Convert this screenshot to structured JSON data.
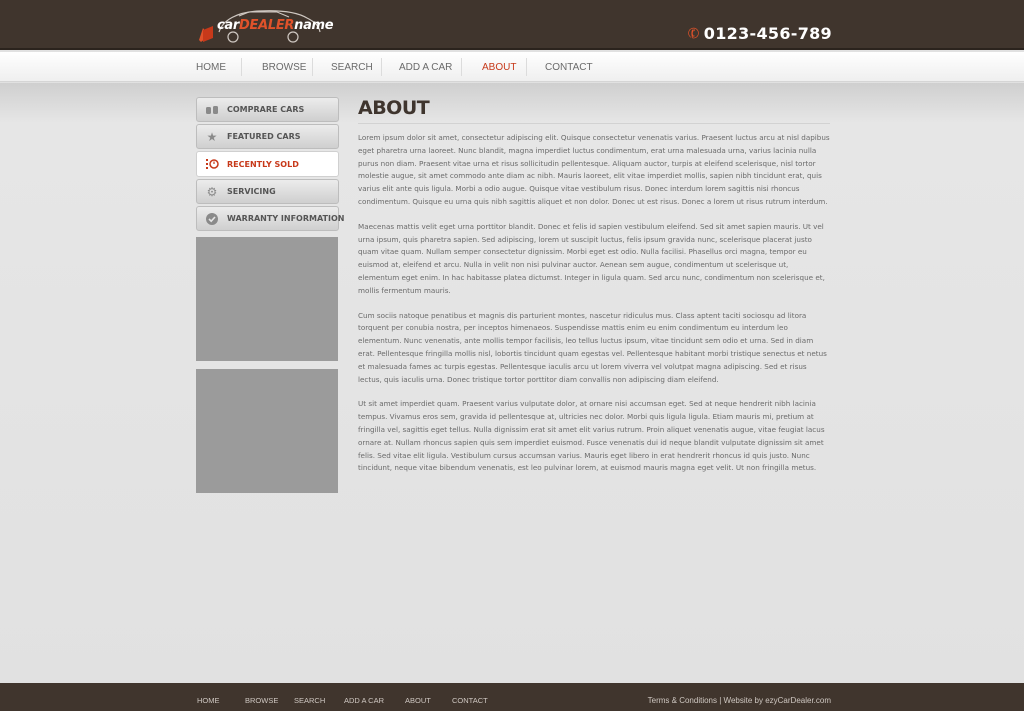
{
  "header": {
    "logo": {
      "part1": "car",
      "part2": "DEALER",
      "part3": "name"
    },
    "phone": "0123-456-789"
  },
  "nav": {
    "items": [
      "HOME",
      "BROWSE",
      "SEARCH",
      "ADD A CAR",
      "ABOUT",
      "CONTACT"
    ],
    "active": "ABOUT"
  },
  "sidebar": {
    "items": [
      {
        "label": "COMPRARE CARS",
        "icon": "compare-icon"
      },
      {
        "label": "FEATURED CARS",
        "icon": "star-icon"
      },
      {
        "label": "RECENTLY SOLD",
        "icon": "sold-icon",
        "active": true
      },
      {
        "label": "SERVICING",
        "icon": "gear-icon"
      },
      {
        "label": "WARRANTY INFORMATION",
        "icon": "check-icon"
      }
    ]
  },
  "main": {
    "title": "ABOUT",
    "paragraphs": [
      "Lorem ipsum dolor sit amet, consectetur adipiscing elit. Quisque consectetur venenatis varius. Praesent luctus arcu at nisl dapibus eget pharetra urna laoreet. Nunc blandit, magna imperdiet luctus condimentum, erat urna malesuada urna, varius lacinia nulla purus non diam. Praesent vitae urna et risus sollicitudin pellentesque. Aliquam auctor, turpis at eleifend scelerisque, nisl tortor molestie augue, sit amet commodo ante diam ac nibh. Mauris laoreet, elit vitae imperdiet mollis, sapien nibh tincidunt erat, quis varius elit ante quis ligula. Morbi a odio augue. Quisque vitae vestibulum risus. Donec interdum lorem sagittis nisi rhoncus condimentum. Quisque eu urna quis nibh sagittis aliquet et non dolor. Donec ut est risus. Donec a lorem ut risus rutrum interdum.",
      "Maecenas mattis velit eget urna porttitor blandit. Donec et felis id sapien vestibulum eleifend. Sed sit amet sapien mauris. Ut vel urna ipsum, quis pharetra sapien. Sed adipiscing, lorem ut suscipit luctus, felis ipsum gravida nunc, scelerisque placerat justo quam vitae quam. Nullam semper consectetur dignissim. Morbi eget est odio. Nulla facilisi. Phasellus orci magna, tempor eu euismod at, eleifend et arcu. Nulla in velit non nisi pulvinar auctor. Aenean sem augue, condimentum ut scelerisque ut, elementum eget enim. In hac habitasse platea dictumst. Integer in ligula quam. Sed arcu nunc, condimentum non scelerisque et, mollis fermentum mauris.",
      "Cum sociis natoque penatibus et magnis dis parturient montes, nascetur ridiculus mus. Class aptent taciti sociosqu ad litora torquent per conubia nostra, per inceptos himenaeos. Suspendisse mattis enim eu enim condimentum eu interdum leo elementum. Nunc venenatis, ante mollis tempor facilisis, leo tellus luctus ipsum, vitae tincidunt sem odio et urna. Sed in diam erat. Pellentesque fringilla mollis nisl, lobortis tincidunt quam egestas vel. Pellentesque habitant morbi tristique senectus et netus et malesuada fames ac turpis egestas. Pellentesque iaculis arcu ut lorem viverra vel volutpat magna adipiscing. Sed et risus lectus, quis iaculis urna. Donec tristique tortor porttitor diam convallis non adipiscing diam eleifend.",
      "Ut sit amet imperdiet quam. Praesent varius vulputate dolor, at ornare nisi accumsan eget. Sed at neque hendrerit nibh lacinia tempus. Vivamus eros sem, gravida id pellentesque at, ultricies nec dolor. Morbi quis ligula ligula. Etiam mauris mi, pretium at fringilla vel, sagittis eget tellus. Nulla dignissim erat sit amet elit varius rutrum. Proin aliquet venenatis augue, vitae feugiat lacus ornare at. Nullam rhoncus sapien quis sem imperdiet euismod. Fusce venenatis dui id neque blandit vulputate dignissim sit amet felis. Sed vitae elit ligula. Vestibulum cursus accumsan varius. Mauris eget libero in erat hendrerit rhoncus id quis justo. Nunc tincidunt, neque vitae bibendum venenatis, est leo pulvinar lorem, at euismod mauris magna eget velit. Ut non fringilla metus."
    ]
  },
  "footer": {
    "links": [
      "HOME",
      "BROWSE",
      "SEARCH",
      "ADD A CAR",
      "ABOUT",
      "CONTACT"
    ],
    "terms": "Terms & Conditions",
    "separator": "|",
    "credit": "Website by ezyCarDealer.com"
  },
  "colors": {
    "header_bg": "#40352d",
    "accent": "#c7391a",
    "page_bg": "#e1e1e1",
    "placeholder": "#9b9b9b"
  }
}
